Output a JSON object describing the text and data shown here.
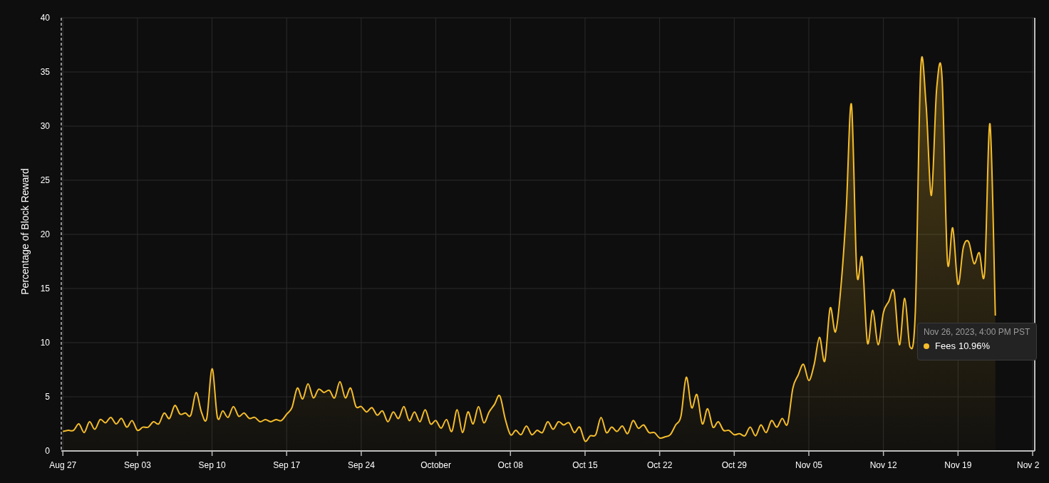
{
  "chart_data": {
    "type": "area",
    "grid": true,
    "ylabel": "Percentage of Block Reward",
    "ylim": [
      0,
      40
    ],
    "yticks": [
      0,
      5,
      10,
      15,
      20,
      25,
      30,
      35,
      40
    ],
    "categories": [
      "Aug 27",
      null,
      null,
      null,
      null,
      null,
      null,
      null,
      null,
      null,
      null,
      null,
      null,
      null,
      "Sep 03",
      null,
      null,
      null,
      null,
      null,
      null,
      null,
      null,
      null,
      null,
      null,
      null,
      null,
      "Sep 10",
      null,
      null,
      null,
      null,
      null,
      null,
      null,
      null,
      null,
      null,
      null,
      null,
      null,
      "Sep 17",
      null,
      null,
      null,
      null,
      null,
      null,
      null,
      null,
      null,
      null,
      null,
      null,
      null,
      "Sep 24",
      null,
      null,
      null,
      null,
      null,
      null,
      null,
      null,
      null,
      null,
      null,
      null,
      null,
      "October",
      null,
      null,
      null,
      null,
      null,
      null,
      null,
      null,
      null,
      null,
      null,
      null,
      null,
      "Oct 08",
      null,
      null,
      null,
      null,
      null,
      null,
      null,
      null,
      null,
      null,
      null,
      null,
      null,
      "Oct 15",
      null,
      null,
      null,
      null,
      null,
      null,
      null,
      null,
      null,
      null,
      null,
      null,
      null,
      "Oct 22",
      null,
      null,
      null,
      null,
      null,
      null,
      null,
      null,
      null,
      null,
      null,
      null,
      null,
      "Oct 29",
      null,
      null,
      null,
      null,
      null,
      null,
      null,
      null,
      null,
      null,
      null,
      null,
      null,
      "Nov 05",
      null,
      null,
      null,
      null,
      null,
      null,
      null,
      null,
      null,
      null,
      null,
      null,
      null,
      "Nov 12",
      null,
      null,
      null,
      null,
      null,
      null,
      null,
      null,
      null,
      null,
      null,
      null,
      null,
      "Nov 19",
      null,
      null,
      null,
      null,
      null,
      null,
      null,
      null,
      null,
      null,
      null,
      null,
      null,
      "Nov 2"
    ],
    "series": [
      {
        "name": "Fees",
        "color": "#f5bd2b",
        "values": [
          1.8,
          1.9,
          1.9,
          2.5,
          1.7,
          2.7,
          2.0,
          2.9,
          2.6,
          3.1,
          2.5,
          3.0,
          2.2,
          2.8,
          1.9,
          2.2,
          2.2,
          2.7,
          2.5,
          3.5,
          3.0,
          4.2,
          3.4,
          3.5,
          3.3,
          5.4,
          3.6,
          3.0,
          7.6,
          3.1,
          3.7,
          3.1,
          4.1,
          3.2,
          3.5,
          3.0,
          3.1,
          2.7,
          2.9,
          2.7,
          2.9,
          2.8,
          3.4,
          4.0,
          5.8,
          4.8,
          6.2,
          4.9,
          5.7,
          5.4,
          5.6,
          4.9,
          6.4,
          4.9,
          5.8,
          4.1,
          4.1,
          3.6,
          4.0,
          3.3,
          3.7,
          2.7,
          3.6,
          3.0,
          4.1,
          2.8,
          3.6,
          2.7,
          3.8,
          2.5,
          2.8,
          2.1,
          2.9,
          1.8,
          3.8,
          1.7,
          3.6,
          2.5,
          4.1,
          2.6,
          3.6,
          4.3,
          5.1,
          3.0,
          1.5,
          1.9,
          1.5,
          2.3,
          1.5,
          1.9,
          1.7,
          2.7,
          2.0,
          2.7,
          2.4,
          2.6,
          1.7,
          2.2,
          0.9,
          1.4,
          1.5,
          3.1,
          1.7,
          2.2,
          1.8,
          2.3,
          1.6,
          2.8,
          2.1,
          2.4,
          1.7,
          1.7,
          1.2,
          1.3,
          1.5,
          2.4,
          3.2,
          6.8,
          4.0,
          5.2,
          2.5,
          3.9,
          2.2,
          2.7,
          1.9,
          1.9,
          1.5,
          1.6,
          1.4,
          2.2,
          1.4,
          2.4,
          1.7,
          2.8,
          2.2,
          3.0,
          2.5,
          5.8,
          7.0,
          8.0,
          6.5,
          8.0,
          10.5,
          8.3,
          13.2,
          11.0,
          15.0,
          22.0,
          32.0,
          16.5,
          17.8,
          10.0,
          13.0,
          9.8,
          12.8,
          13.8,
          14.7,
          9.8,
          14.1,
          9.6,
          13.0,
          35.3,
          32.0,
          23.6,
          33.5,
          34.5,
          17.6,
          20.6,
          15.4,
          18.8,
          19.3,
          17.3,
          18.3,
          16.5,
          30.2,
          12.5,
          null,
          null,
          null,
          null,
          null,
          null,
          null
        ]
      }
    ]
  },
  "tooltip": {
    "title": "Nov 26, 2023, 4:00 PM PST",
    "value": "10.96%",
    "color": "#f5bd2b"
  }
}
